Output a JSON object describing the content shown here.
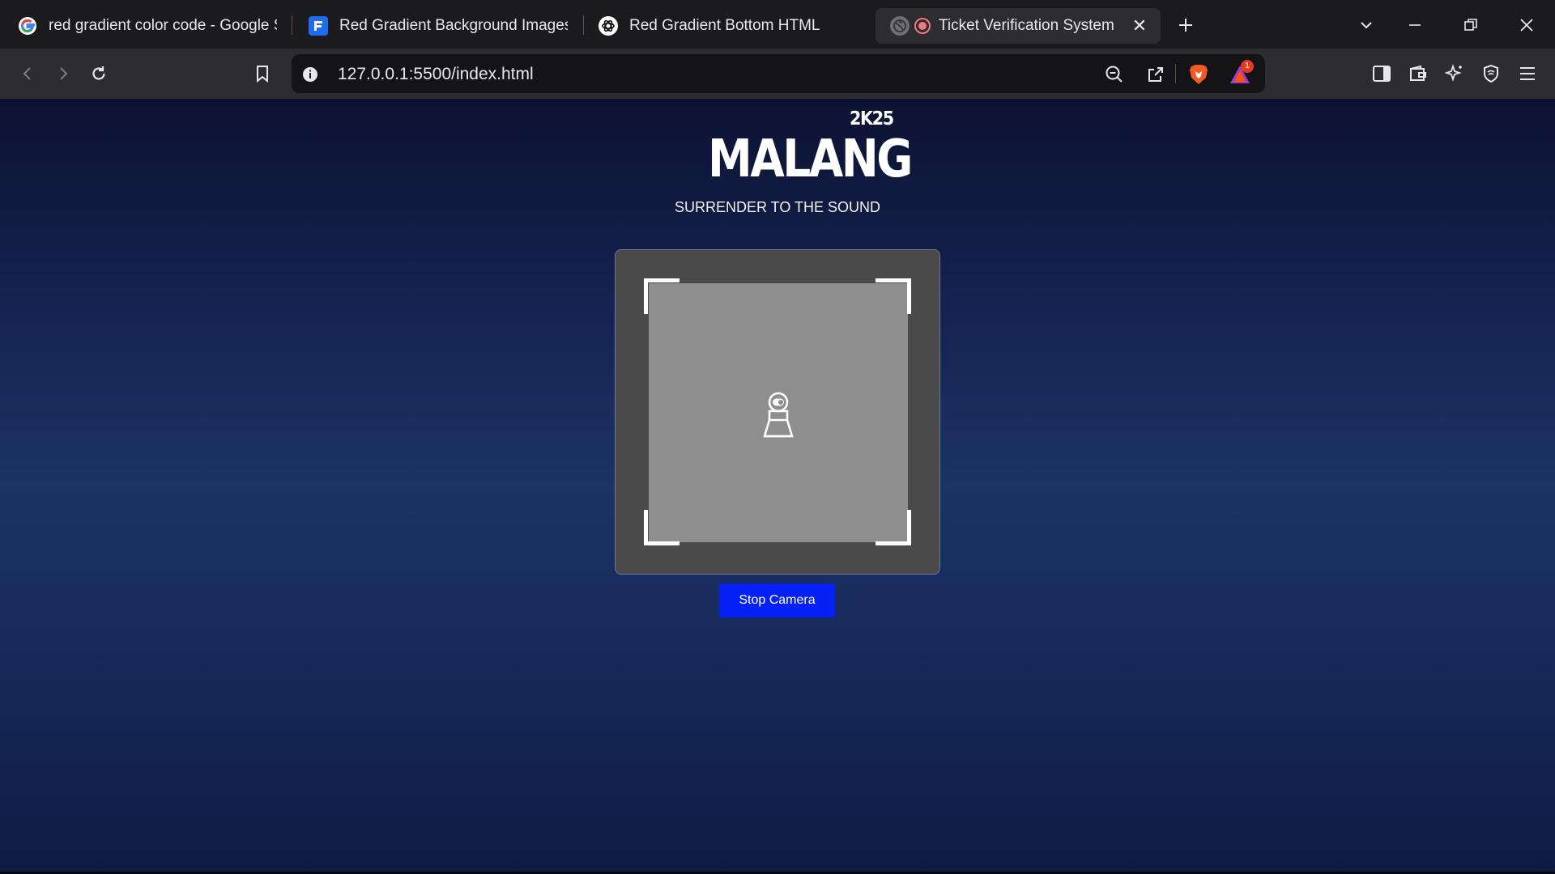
{
  "browser": {
    "tabs": [
      {
        "title": "red gradient color code - Google Se",
        "favicon": "google-icon",
        "active": false
      },
      {
        "title": "Red Gradient Background Images -",
        "favicon": "freepik-icon",
        "active": false
      },
      {
        "title": "Red Gradient Bottom HTML",
        "favicon": "chatgpt-icon",
        "active": false
      },
      {
        "title": "Ticket Verification System",
        "favicon": "globe-icon",
        "active": true,
        "recording": true
      }
    ],
    "url": "127.0.0.1:5500/index.html",
    "notification_count": "1"
  },
  "page": {
    "brand_year": "2K25",
    "brand_title": "MALANG",
    "tagline": "SURRENDER TO THE SOUND",
    "scanner_state": "camera-placeholder",
    "stop_button_label": "Stop Camera"
  },
  "colors": {
    "button_bg": "#0521f5",
    "scanner_frame": "#4a4a4a",
    "viewport": "#8e8e8e",
    "page_gradient_top": "#0c1232",
    "page_gradient_mid": "#1c3364"
  }
}
